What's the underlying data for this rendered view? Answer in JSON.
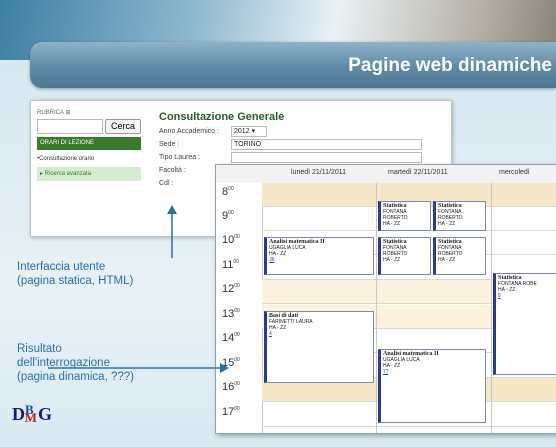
{
  "slide_title": "Pagine web dinamiche",
  "left_panel": {
    "rubrica": "RUBRICA  ⊞",
    "search_button": "Cerca",
    "menu_header": "ORARI DI LEZIONE",
    "menu_item_1": "•Consultazione orario",
    "menu_item_2": "▸ Ricerca avanzata"
  },
  "form": {
    "title": "Consultazione Generale",
    "anno_label": "Anno Accademico :",
    "anno_value": "2012 ▾",
    "sede_label": "Sede :",
    "sede_value": "TORINO",
    "tipo_label": "Tipo Laurea :",
    "facolta_label": "Facoltà :",
    "cdl_label": "Cdl :"
  },
  "calendar": {
    "days": [
      "lunedì 21/11/2011",
      "martedì 22/11/2011",
      "mercoledì"
    ],
    "hours": [
      "8",
      "9",
      "10",
      "11",
      "12",
      "13",
      "14",
      "15",
      "16",
      "17"
    ],
    "events": {
      "stat1": {
        "title": "Statistica",
        "l1": "FONTANA",
        "l2": "ROBERTO",
        "l3": "HA - ZZ"
      },
      "stat2": {
        "title": "Statistica",
        "l1": "FONTANA",
        "l2": "ROBERTO",
        "l3": "HA - ZZ"
      },
      "analisi1": {
        "title": "Analisi matematica II",
        "l1": "UGAGLIA LUCA",
        "l2": "HA - ZZ",
        "link": "36"
      },
      "stat3": {
        "title": "Statistica",
        "l1": "FONTANA",
        "l2": "ROBERTO",
        "l3": "HA - ZZ"
      },
      "stat4": {
        "title": "Statistica",
        "l1": "FONTANA",
        "l2": "ROBERTO",
        "l3": "HA - ZZ"
      },
      "stat5": {
        "title": "Statistica",
        "l1": "FONTANA ROBE",
        "l2": "HA - ZZ",
        "link": "8"
      },
      "basi": {
        "title": "Basi di dati",
        "l1": "FARINETTI LAURA",
        "l2": "HA - ZZ",
        "link": "4"
      },
      "analisi2": {
        "title": "Analisi matematica II",
        "l1": "UGAGLIA LUCA",
        "l2": "HA - ZZ",
        "link": "77"
      }
    }
  },
  "notes": {
    "interface_l1": "Interfaccia utente",
    "interface_l2": "(pagina statica, HTML)",
    "result_l1": "Risultato",
    "result_l2": "dell'interrogazione",
    "result_l3": "(pagina dinamica, ???)"
  },
  "logo": {
    "d": "D",
    "b": "B",
    "m": "M",
    "g": "G"
  }
}
